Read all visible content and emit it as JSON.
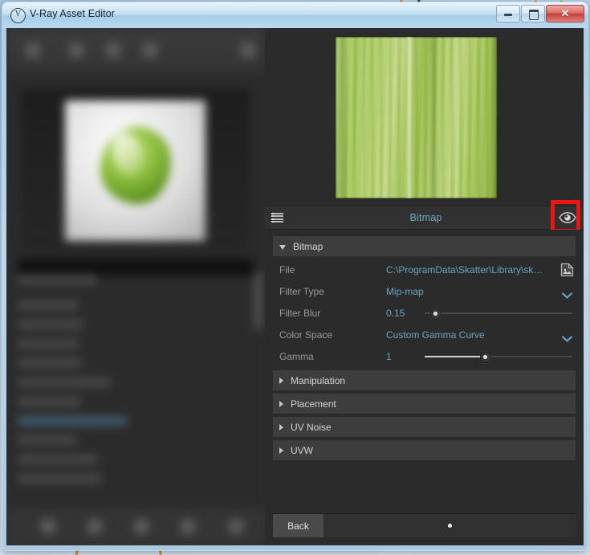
{
  "window": {
    "title": "V-Ray Asset Editor",
    "app_icon": "vray-logo-icon",
    "controls": {
      "minimize_label": "",
      "maximize_label": "",
      "close_label": "✕"
    }
  },
  "left_panel": {
    "state": "blurred",
    "note": "asset list and material preview (out of focus)"
  },
  "right_panel": {
    "texture_preview": {
      "name": "leaf-texture-preview",
      "dominant_color": "#aecb63"
    },
    "header": {
      "menu_icon": "list-menu-icon",
      "title": "Bitmap",
      "eye_icon": "eye-icon",
      "eye_highlighted": true,
      "highlight_color": "#ef1414"
    },
    "groups": [
      {
        "label": "Bitmap",
        "expanded": true,
        "rows": [
          {
            "label": "File",
            "type": "file",
            "value": "C:\\ProgramData\\Skatter\\Library\\ska...",
            "button_icon": "image-file-icon"
          },
          {
            "label": "Filter Type",
            "type": "dropdown",
            "value": "Mip-map",
            "chevron_icon": "chevron-down-icon"
          },
          {
            "label": "Filter Blur",
            "type": "slider",
            "value": "0.15",
            "fill_percent": 0,
            "knob_percent": 7
          },
          {
            "label": "Color Space",
            "type": "dropdown",
            "value": "Custom Gamma Curve",
            "chevron_icon": "chevron-down-icon"
          },
          {
            "label": "Gamma",
            "type": "slider",
            "value": "1",
            "fill_percent": 41,
            "knob_percent": 41
          }
        ]
      },
      {
        "label": "Manipulation",
        "expanded": false,
        "rows": []
      },
      {
        "label": "Placement",
        "expanded": false,
        "rows": []
      },
      {
        "label": "UV Noise",
        "expanded": false,
        "rows": []
      },
      {
        "label": "UVW",
        "expanded": false,
        "rows": []
      }
    ],
    "footer": {
      "back_label": "Back",
      "page_indicator": "•"
    }
  },
  "colors": {
    "panel_bg": "#2b2b2b",
    "group_header_bg": "#3d3d3d",
    "label_text": "#9a9a9a",
    "value_text": "#66a5c2",
    "title_text": "#74a8c4",
    "highlight_red": "#ef1414"
  }
}
